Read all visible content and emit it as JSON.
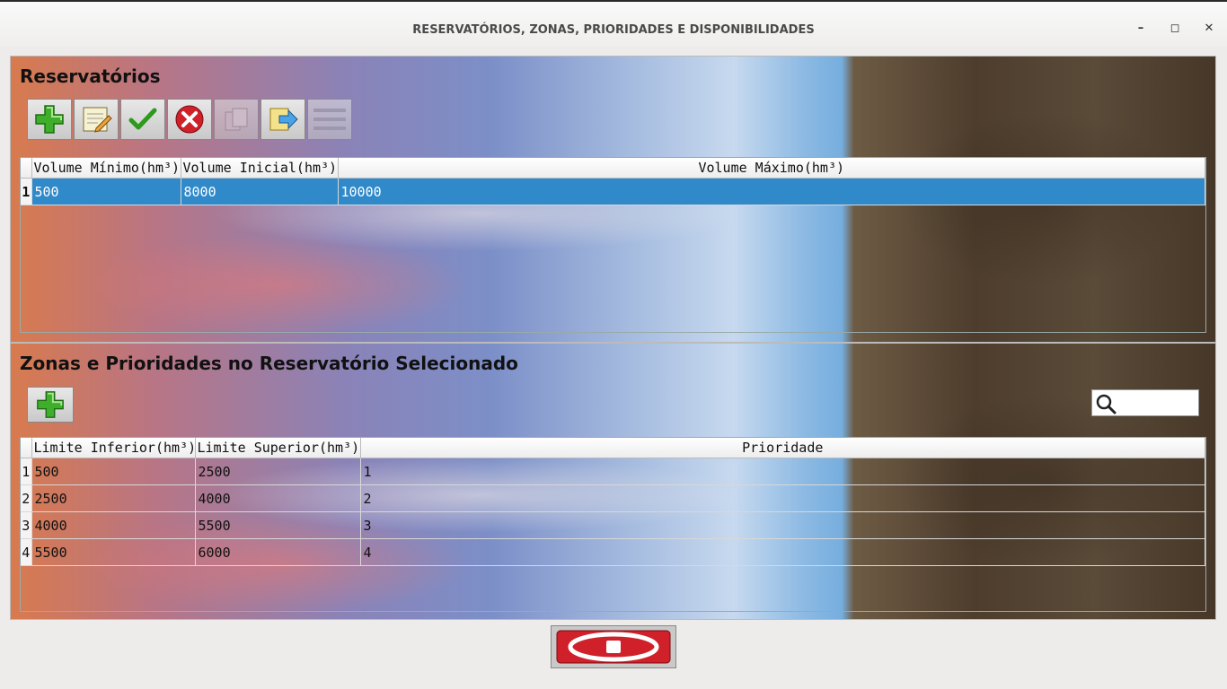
{
  "window": {
    "title": "RESERVATÓRIOS, ZONAS, PRIORIDADES E DISPONIBILIDADES",
    "minimize": "–",
    "maximize": "◻",
    "close": "✕"
  },
  "reservoirs": {
    "heading": "Reservatórios",
    "toolbar": [
      "add-icon",
      "edit-icon",
      "confirm-icon",
      "cancel-icon",
      "copy-icon",
      "export-icon",
      "menu-icon"
    ],
    "columns": [
      "Volume Mínimo(hm³)",
      "Volume Inicial(hm³)",
      "Volume Máximo(hm³)"
    ],
    "rows": [
      {
        "num": "1",
        "cells": [
          "500",
          "8000",
          "10000"
        ]
      }
    ]
  },
  "zones": {
    "heading": "Zonas e Prioridades no Reservatório Selecionado",
    "search_placeholder": "",
    "columns": [
      "Limite Inferior(hm³)",
      "Limite Superior(hm³)",
      "Prioridade"
    ],
    "rows": [
      {
        "num": "1",
        "cells": [
          "500",
          "2500",
          "1"
        ]
      },
      {
        "num": "2",
        "cells": [
          "2500",
          "4000",
          "2"
        ]
      },
      {
        "num": "3",
        "cells": [
          "4000",
          "5500",
          "3"
        ]
      },
      {
        "num": "4",
        "cells": [
          "5500",
          "6000",
          "4"
        ]
      }
    ]
  },
  "colors": {
    "selection": "#3089c9",
    "stop_button": "#d0202a"
  }
}
